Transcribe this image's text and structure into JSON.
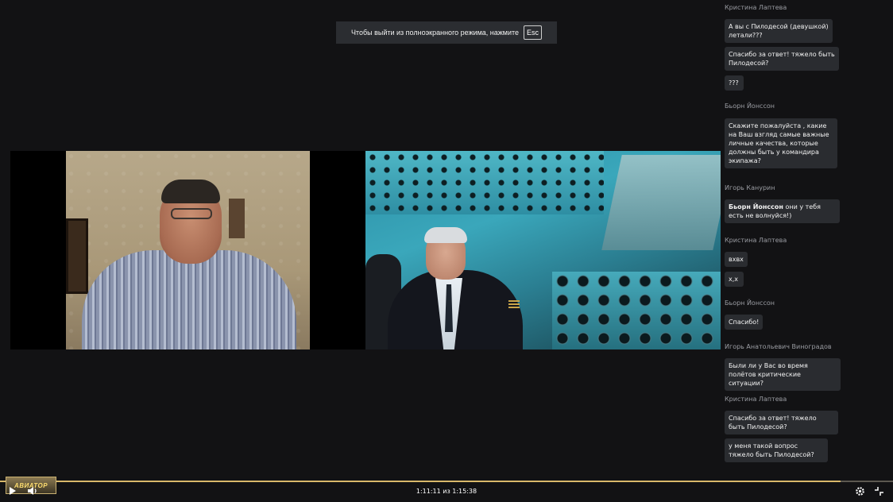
{
  "fullscreen_notice": {
    "text": "Чтобы выйти из полноэкранного режима, нажмите",
    "key": "Esc"
  },
  "chat": {
    "messages": [
      {
        "author": "Кристина Лаптева",
        "text": "А вы с Пилодесой (девушкой) летали???"
      },
      {
        "author": "",
        "text": "Спасибо за ответ! тяжело быть Пилодесой?"
      },
      {
        "author": "",
        "text": "???"
      },
      {
        "author": "Бьорн Йонссон",
        "text": "Скажите пожалуйста , какие на Ваш взгляд самые важные личные качества, которые должны быть у командира экипажа?"
      },
      {
        "author": "Игорь Канурин",
        "mention": "Бьорн Йонссон",
        "text": "они у тебя есть не волнуйся!)"
      },
      {
        "author": "Кристина Лаптева",
        "text": "вхвх"
      },
      {
        "author": "",
        "text": "x,x"
      },
      {
        "author": "Бьорн Йонссон",
        "text": "Спасибо!"
      },
      {
        "author": "Игорь Анатольевич Виноградов",
        "text": "Были ли у Вас во время полётов критические ситуации?"
      },
      {
        "author": "Кристина Лаптева",
        "text": "Спасибо за ответ! тяжело быть Пилодесой?"
      },
      {
        "author": "",
        "text": "у меня такой вопрос тяжело быть Пилодесой?"
      }
    ]
  },
  "player": {
    "logo_text": "АВИАТОР",
    "time_text": "1:11:11 из 1:15:38",
    "progress": 0.941,
    "play_icon": "play-icon",
    "volume_icon": "volume-icon",
    "settings_icon": "gear-icon",
    "exit_fullscreen_icon": "exit-fullscreen-icon"
  }
}
